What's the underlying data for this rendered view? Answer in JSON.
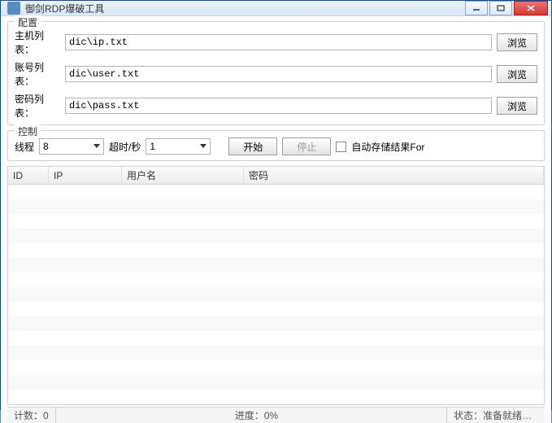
{
  "window": {
    "title": "御剑RDP爆破工具"
  },
  "config": {
    "legend": "配置",
    "host_label": "主机列表：",
    "host_value": "dic\\ip.txt",
    "user_label": "账号列表：",
    "user_value": "dic\\user.txt",
    "pass_label": "密码列表：",
    "pass_value": "dic\\pass.txt",
    "browse": "浏览"
  },
  "control": {
    "legend": "控制",
    "threads_label": "线程",
    "threads_value": "8",
    "timeout_label": "超时/秒",
    "timeout_value": "1",
    "start": "开始",
    "stop": "停止",
    "autosave": "自动存储结果For"
  },
  "table": {
    "cols": {
      "id": "ID",
      "ip": "IP",
      "user": "用户名",
      "pass": "密码"
    }
  },
  "status": {
    "count_label": "计数：",
    "count_value": "0",
    "progress_label": "进度：",
    "progress_value": "0%",
    "state_label": "状态：",
    "state_value": "准备就绪…"
  }
}
